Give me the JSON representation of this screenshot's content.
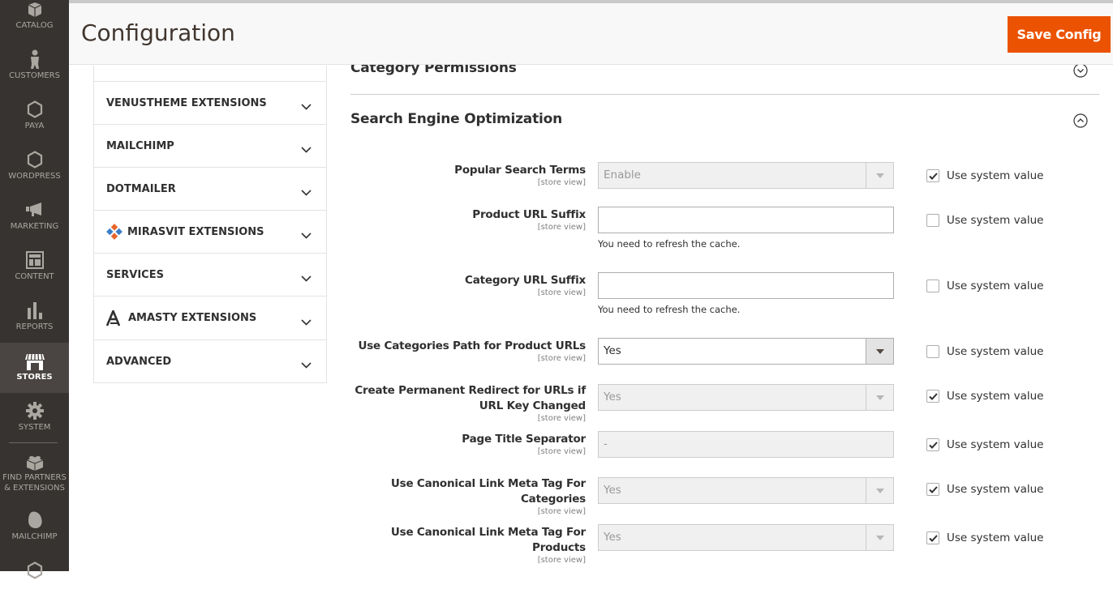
{
  "nav": {
    "items": [
      {
        "label": "Catalog",
        "icon": "box-icon"
      },
      {
        "label": "Customers",
        "icon": "person-icon"
      },
      {
        "label": "Paya",
        "icon": "hexagon-icon"
      },
      {
        "label": "Wordpress",
        "icon": "hexagon-icon"
      },
      {
        "label": "Marketing",
        "icon": "megaphone-icon"
      },
      {
        "label": "Content",
        "icon": "layout-icon"
      },
      {
        "label": "Reports",
        "icon": "bar-chart-icon"
      },
      {
        "label": "Stores",
        "icon": "store-icon",
        "active": true
      },
      {
        "label": "System",
        "icon": "gear-icon"
      },
      {
        "label": "Find Partners",
        "label2": "& Extensions",
        "icon": "lego-brick-icon"
      },
      {
        "label": "Mailchimp",
        "icon": "mailchimp-icon"
      }
    ]
  },
  "header": {
    "title": "Configuration",
    "save_label": "Save Config"
  },
  "tabs": [
    {
      "label": "VENUSTHEME EXTENSIONS"
    },
    {
      "label": "MAILCHIMP"
    },
    {
      "label": "DOTMAILER"
    },
    {
      "label": "MIRASVIT EXTENSIONS",
      "logo": "mirasvit-logo-icon"
    },
    {
      "label": "SERVICES"
    },
    {
      "label": "AMASTY EXTENSIONS",
      "logo": "amasty-logo-icon"
    },
    {
      "label": "ADVANCED"
    }
  ],
  "sections": {
    "category_permissions": "Category Permissions",
    "seo": "Search Engine Optimization"
  },
  "scope_label": "[store view]",
  "system_value_label": "Use system value",
  "refresh_note": "You need to refresh the cache.",
  "fields": [
    {
      "label": "Popular Search Terms",
      "type": "select",
      "value": "Enable",
      "disabled": true,
      "use_system": true
    },
    {
      "label": "Product URL Suffix",
      "type": "text",
      "value": "",
      "disabled": false,
      "use_system": false,
      "note": true
    },
    {
      "label": "Category URL Suffix",
      "type": "text",
      "value": "",
      "disabled": false,
      "use_system": false,
      "note": true
    },
    {
      "label": "Use Categories Path for Product URLs",
      "type": "select",
      "value": "Yes",
      "disabled": false,
      "use_system": false
    },
    {
      "label": "Create Permanent Redirect for URLs if URL Key Changed",
      "type": "select",
      "value": "Yes",
      "disabled": true,
      "use_system": true
    },
    {
      "label": "Page Title Separator",
      "type": "text",
      "value": "-",
      "disabled": true,
      "use_system": true
    },
    {
      "label": "Use Canonical Link Meta Tag For Categories",
      "type": "select",
      "value": "Yes",
      "disabled": true,
      "use_system": true
    },
    {
      "label": "Use Canonical Link Meta Tag For Products",
      "type": "select",
      "value": "Yes",
      "disabled": true,
      "use_system": true
    }
  ]
}
